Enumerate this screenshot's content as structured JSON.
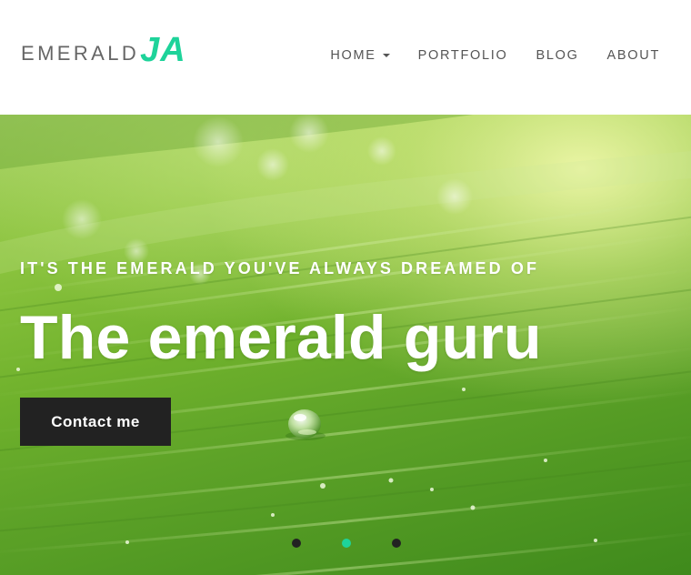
{
  "brand": {
    "name_main": "EMERALD",
    "name_accent": "JA",
    "accent_color": "#1ed39a",
    "text_color": "#666666"
  },
  "nav": {
    "items": [
      {
        "label": "HOME",
        "has_dropdown": true,
        "icon": "caret-down-icon"
      },
      {
        "label": "PORTFOLIO",
        "has_dropdown": false
      },
      {
        "label": "BLOG",
        "has_dropdown": false
      },
      {
        "label": "ABOUT",
        "has_dropdown": false
      }
    ]
  },
  "hero": {
    "tagline": "IT'S THE EMERALD YOU'VE ALWAYS DREAMED OF",
    "title": "The emerald guru",
    "button_label": "Contact me",
    "background": "green leaf with water droplet",
    "slider": {
      "total": 3,
      "active_index": 1,
      "active_color": "#1ed39a",
      "inactive_color": "#222222"
    }
  }
}
